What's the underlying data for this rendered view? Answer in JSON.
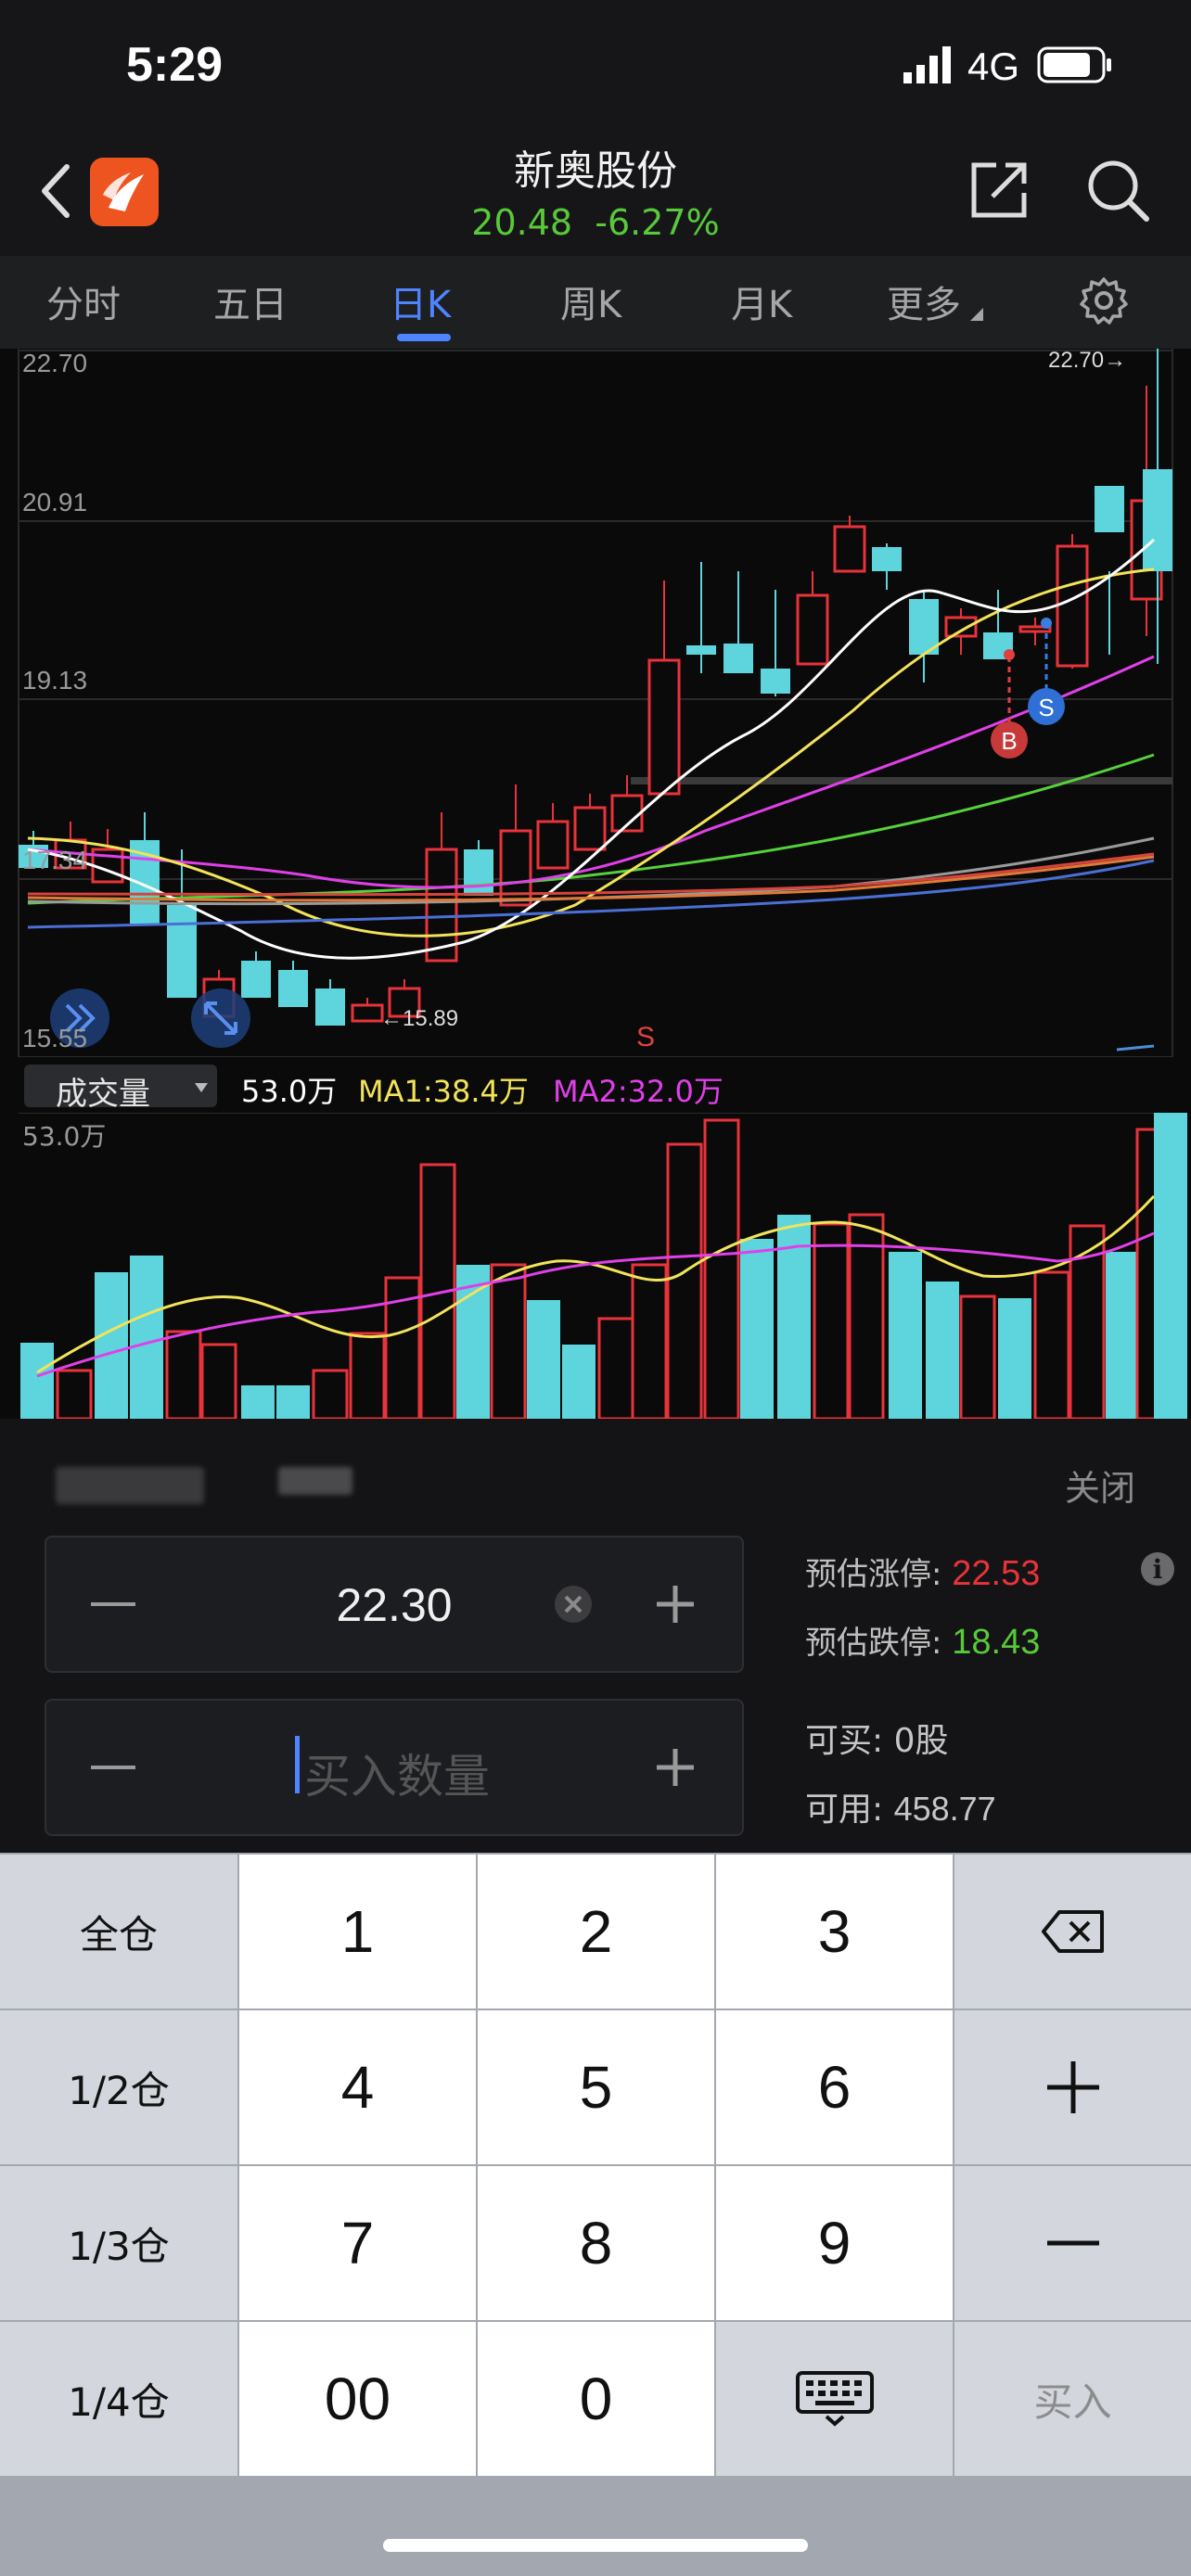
{
  "status_bar": {
    "time": "5:29",
    "network": "4G"
  },
  "header": {
    "stock_name": "新奥股份",
    "price": "20.48",
    "change_pct": "-6.27%"
  },
  "tabs": [
    {
      "label": "分时",
      "active": false
    },
    {
      "label": "五日",
      "active": false
    },
    {
      "label": "日K",
      "active": true
    },
    {
      "label": "周K",
      "active": false
    },
    {
      "label": "月K",
      "active": false
    },
    {
      "label": "更多",
      "active": false
    }
  ],
  "kline": {
    "price_labels": [
      "22.70",
      "20.91",
      "19.13",
      "17.34",
      "15.55"
    ],
    "high_marker": "22.70",
    "low_marker": "15.89",
    "signal_B": "B",
    "signal_S": "S",
    "signal_S_bottom": "S"
  },
  "volume": {
    "selector_label": "成交量",
    "current": "53.0万",
    "ma1": "MA1:38.4万",
    "ma2": "MA2:32.0万",
    "scale_max": "53.0万"
  },
  "trade": {
    "close_label": "关闭",
    "price_value": "22.30",
    "qty_placeholder": "买入数量",
    "limit_up_label": "预估涨停:",
    "limit_up_value": "22.53",
    "limit_down_label": "预估跌停:",
    "limit_down_value": "18.43",
    "can_buy_label": "可买:",
    "can_buy_value": "0股",
    "available_label": "可用:",
    "available_value": "458.77"
  },
  "keyboard": {
    "row1": [
      "全仓",
      "1",
      "2",
      "3"
    ],
    "row2": [
      "1/2仓",
      "4",
      "5",
      "6"
    ],
    "row3": [
      "1/3仓",
      "7",
      "8",
      "9"
    ],
    "row4": [
      "1/4仓",
      "00",
      "0",
      "买入"
    ]
  },
  "colors": {
    "up": "#e8333a",
    "down": "#5ed5dc",
    "accent": "#4f84ff",
    "green": "#58c93a",
    "ma5": "#ffffff",
    "ma10": "#f2e35a",
    "ma20": "#e040e8",
    "ma30": "#55d13c"
  }
}
